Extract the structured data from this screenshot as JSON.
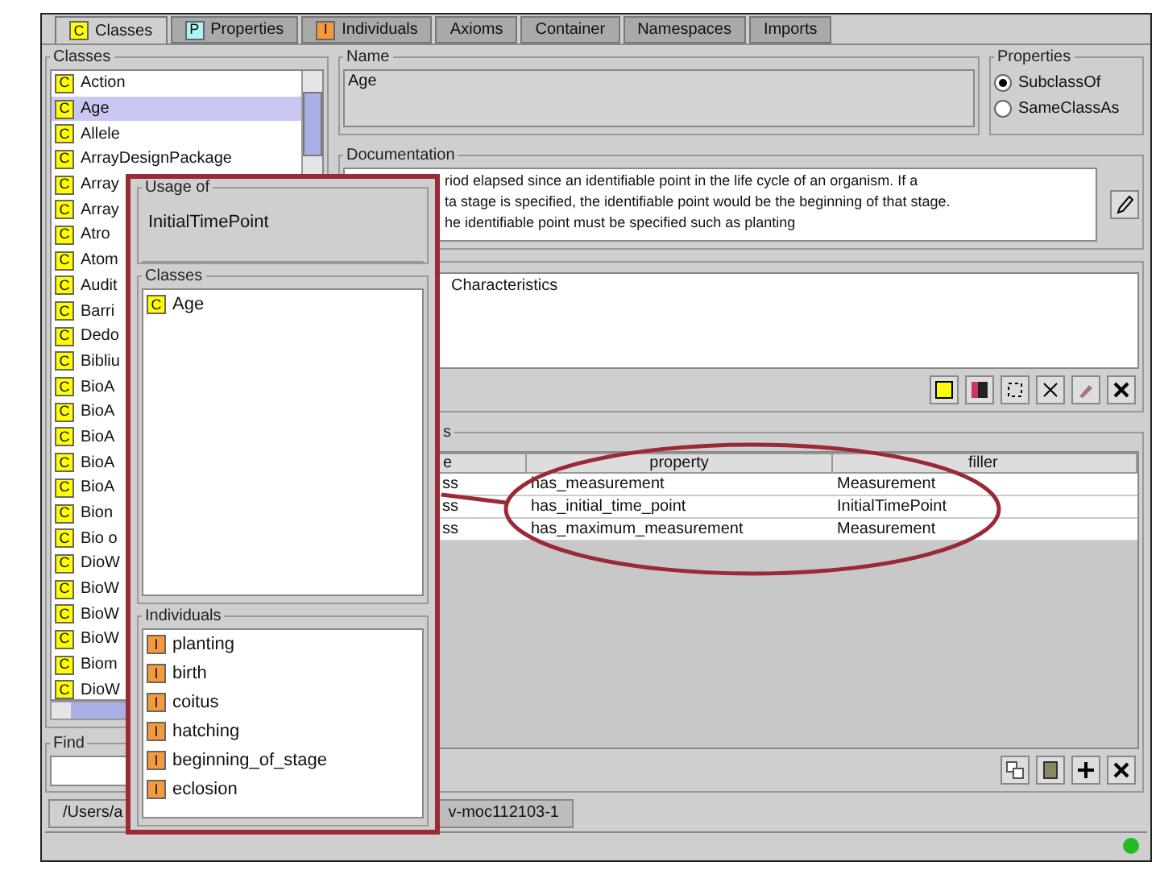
{
  "tabs": [
    {
      "label": "Classes",
      "icon": "C",
      "selected": true
    },
    {
      "label": "Properties",
      "icon": "P",
      "selected": false
    },
    {
      "label": "Individuals",
      "icon": "I",
      "selected": false
    },
    {
      "label": "Axioms",
      "selected": false
    },
    {
      "label": "Container",
      "selected": false
    },
    {
      "label": "Namespaces",
      "selected": false
    },
    {
      "label": "Imports",
      "selected": false
    }
  ],
  "classes_panel": {
    "title": "Classes",
    "items": [
      {
        "badge": "C",
        "name": "Action",
        "selected": false
      },
      {
        "badge": "C",
        "name": "Age",
        "selected": true
      },
      {
        "badge": "C",
        "name": "Allele",
        "selected": false
      },
      {
        "badge": "C",
        "name": "ArrayDesignPackage",
        "selected": false
      },
      {
        "badge": "C",
        "name": "Array",
        "selected": false
      },
      {
        "badge": "C",
        "name": "Array",
        "selected": false
      },
      {
        "badge": "C",
        "name": "Atro",
        "selected": false
      },
      {
        "badge": "C",
        "name": "Atom",
        "selected": false
      },
      {
        "badge": "C",
        "name": "Audit",
        "selected": false
      },
      {
        "badge": "C",
        "name": "Barri",
        "selected": false
      },
      {
        "badge": "C",
        "name": "Dedo",
        "selected": false
      },
      {
        "badge": "C",
        "name": "Bibliu",
        "selected": false
      },
      {
        "badge": "C",
        "name": "BioA",
        "selected": false
      },
      {
        "badge": "C",
        "name": "BioA",
        "selected": false
      },
      {
        "badge": "C",
        "name": "BioA",
        "selected": false
      },
      {
        "badge": "C",
        "name": "BioA",
        "selected": false
      },
      {
        "badge": "C",
        "name": "BioA",
        "selected": false
      },
      {
        "badge": "C",
        "name": "Bion",
        "selected": false
      },
      {
        "badge": "C",
        "name": "Bio o",
        "selected": false
      },
      {
        "badge": "C",
        "name": "DioW",
        "selected": false
      },
      {
        "badge": "C",
        "name": "BioW",
        "selected": false
      },
      {
        "badge": "C",
        "name": "BioW",
        "selected": false
      },
      {
        "badge": "C",
        "name": "BioW",
        "selected": false
      },
      {
        "badge": "C",
        "name": "Biom",
        "selected": false
      },
      {
        "badge": "C",
        "name": "DioW",
        "selected": false
      }
    ]
  },
  "find": {
    "title": "Find"
  },
  "name_panel": {
    "title": "Name",
    "value": "Age"
  },
  "properties_panel": {
    "title": "Properties",
    "options": [
      {
        "label": "SubclassOf",
        "selected": true
      },
      {
        "label": "SameClassAs",
        "selected": false
      }
    ]
  },
  "documentation": {
    "title": "Documentation",
    "lines": [
      "riod elapsed since an identifiable point in the life cycle of an organism. If a",
      "ta stage is specified, the identifiable point would be the beginning of that stage.",
      "he identifiable point must be specified such as planting"
    ]
  },
  "characteristics": {
    "text": "Characteristics"
  },
  "conditions": {
    "title": "s",
    "columns": [
      "e",
      "property",
      "filler"
    ],
    "rows": [
      [
        "ss",
        "has_measurement",
        "Measurement"
      ],
      [
        "ss",
        "has_initial_time_point",
        "InitialTimePoint"
      ],
      [
        "ss",
        "has_maximum_measurement",
        "Measurement"
      ]
    ]
  },
  "file_tabs": [
    {
      "label": "/Users/a",
      "selected": true
    },
    {
      "label": "v-moc112103-1",
      "selected": false
    }
  ],
  "usage_popup": {
    "title": "Usage of",
    "subject": "InitialTimePoint",
    "classes_title": "Classes",
    "classes": [
      {
        "badge": "C",
        "name": "Age"
      }
    ],
    "individuals_title": "Individuals",
    "individuals": [
      {
        "badge": "I",
        "name": "planting"
      },
      {
        "badge": "I",
        "name": "birth"
      },
      {
        "badge": "I",
        "name": "coitus"
      },
      {
        "badge": "I",
        "name": "hatching"
      },
      {
        "badge": "I",
        "name": "beginning_of_stage"
      },
      {
        "badge": "I",
        "name": "eclosion"
      }
    ]
  }
}
